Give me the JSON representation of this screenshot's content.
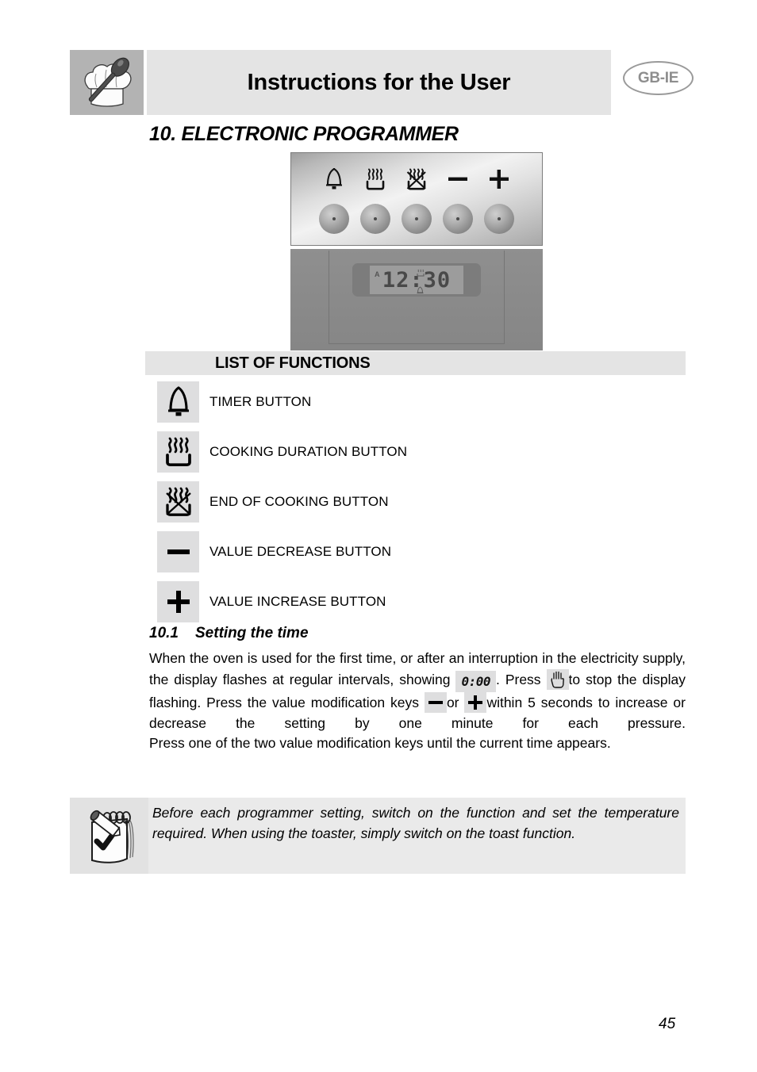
{
  "header": {
    "title": "Instructions for the User",
    "language_badge": "GB-IE",
    "chef_icon": "chef-hat-spoon-icon"
  },
  "section": {
    "heading": "10. ELECTRONIC PROGRAMMER"
  },
  "programmer": {
    "symbols": [
      {
        "name": "bell-timer-symbol",
        "label": "timer"
      },
      {
        "name": "cooking-duration-symbol",
        "label": "cooking duration"
      },
      {
        "name": "end-of-cooking-symbol",
        "label": "end of cooking"
      },
      {
        "name": "minus-symbol",
        "label": "decrease"
      },
      {
        "name": "plus-symbol",
        "label": "increase"
      }
    ],
    "knob_count": 5,
    "display": {
      "time": "12:30",
      "auto_indicator": "A",
      "mini_top_icon": "pot-icon",
      "mini_bottom_icon": "bell-icon"
    }
  },
  "functions_section": {
    "band_title": "LIST OF FUNCTIONS",
    "items": [
      {
        "icon": "bell-timer-icon",
        "label": "TIMER BUTTON"
      },
      {
        "icon": "cooking-duration-icon",
        "label": "COOKING DURATION BUTTON"
      },
      {
        "icon": "end-of-cooking-icon",
        "label": "END OF COOKING BUTTON"
      },
      {
        "icon": "minus-icon",
        "label": "VALUE DECREASE BUTTON"
      },
      {
        "icon": "plus-icon",
        "label": "VALUE INCREASE BUTTON"
      }
    ]
  },
  "subsection": {
    "number": "10.1",
    "title": "Setting the time",
    "paragraph1_part1": "When the oven is used for the first time, or after an interruption in the electricity supply, the display flashes at regular intervals, showing",
    "inline_display_value": "0:00",
    "paragraph1_part2": ". Press",
    "inline_hand_icon": "hand-press-icon",
    "paragraph1_part3": "to stop the display flashing. Press the value modification keys",
    "inline_minus_icon": "minus-icon",
    "paragraph1_or": "or",
    "inline_plus_icon": "plus-icon",
    "paragraph1_part4": "within 5 seconds to increase or decrease the setting by one minute for each pressure.",
    "paragraph2": "Press one of the two value modification keys until the current time appears."
  },
  "note": {
    "icon": "notepad-check-icon",
    "text": "Before each programmer setting, switch on the function and set the temperature required. When using the toaster, simply switch on the toast function."
  },
  "footer": {
    "page_number": "45"
  }
}
